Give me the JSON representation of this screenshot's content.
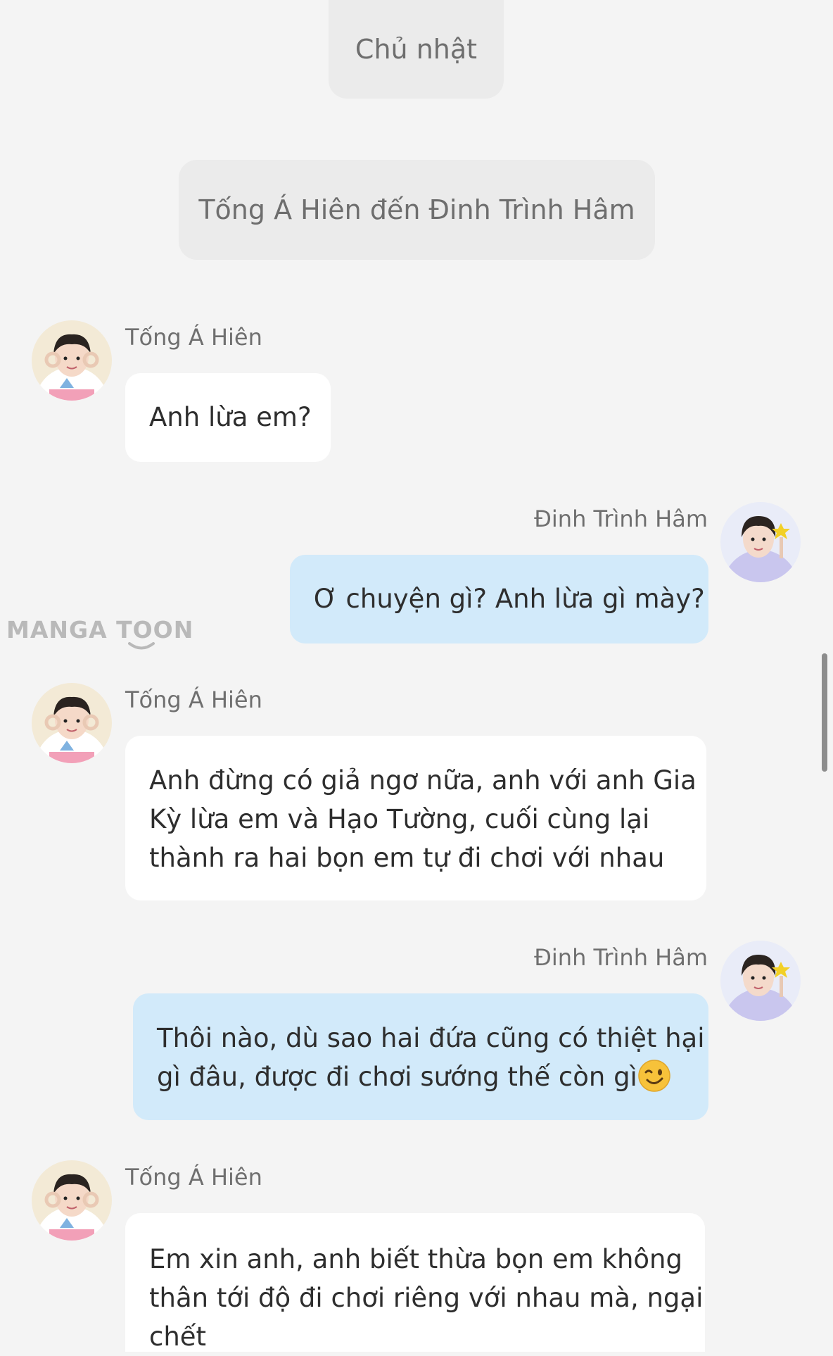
{
  "chat": {
    "day_label": "Chủ nhật",
    "conversation_label": "Tống Á Hiên đến Đinh Trình Hâm",
    "messages": [
      {
        "side": "left",
        "sender": "Tống Á Hiên",
        "lines": [
          "Anh lừa em?"
        ]
      },
      {
        "side": "right",
        "sender": "Đinh Trình Hâm",
        "lines": [
          "Ơ chuyện gì? Anh lừa gì mày?"
        ]
      },
      {
        "side": "left",
        "sender": "Tống Á Hiên",
        "lines": [
          "Anh đừng có giả ngơ nữa, anh với anh Gia",
          "Kỳ lừa em và Hạo Tường, cuối cùng lại",
          "thành ra hai bọn em tự đi chơi với nhau"
        ]
      },
      {
        "side": "right",
        "sender": "Đinh Trình Hâm",
        "lines": [
          "Thôi nào, dù sao hai đứa cũng có thiệt hại",
          "gì đâu, được đi chơi sướng thế còn gì"
        ],
        "emoji": "winking-face"
      },
      {
        "side": "left",
        "sender": "Tống Á Hiên",
        "lines": [
          "Em xin anh, anh biết thừa bọn em không",
          "thân tới độ đi chơi riêng với nhau mà, ngại",
          "chết"
        ]
      }
    ]
  },
  "watermark": "MANGA TOON",
  "colors": {
    "background": "#f4f4f4",
    "left_bubble": "#ffffff",
    "right_bubble": "#d2eafa",
    "system_pill": "#ebebeb"
  }
}
